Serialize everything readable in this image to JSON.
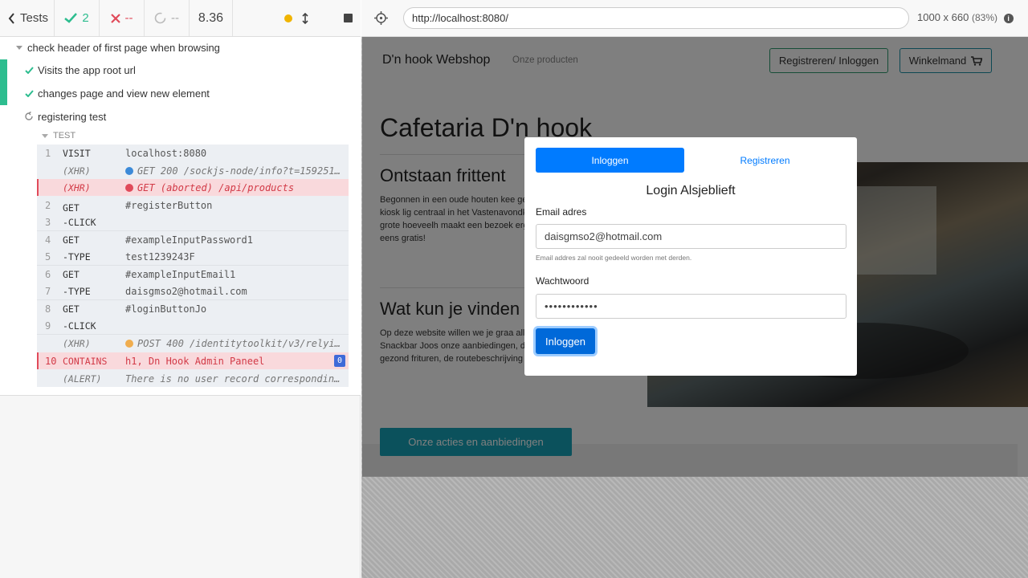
{
  "reporter": {
    "header": {
      "back_label": "Tests",
      "passed_count": "2",
      "failed_count": "--",
      "pending_count": "--",
      "duration": "8.36"
    },
    "suite_title": "check header of first page when browsing",
    "tests": [
      {
        "title": "Visits the app root url",
        "state": "passed"
      },
      {
        "title": "changes page and view new element",
        "state": "passed"
      },
      {
        "title": "registering test",
        "state": "running"
      }
    ],
    "section_label": "TEST",
    "commands": [
      {
        "num": "1",
        "name": "VISIT",
        "message": "localhost:8080",
        "type": "cmd"
      },
      {
        "num": "",
        "name": "(XHR)",
        "message": "GET 200 /sockjs-node/info?t=159251…",
        "type": "xhr",
        "dot": "#3c8ad8"
      },
      {
        "num": "",
        "name": "(XHR)",
        "message": "GET (aborted) /api/products",
        "type": "xhr-err",
        "dot": "#e04a5a"
      },
      {
        "num": "2",
        "name": "GET",
        "message": "#registerButton",
        "type": "cmd"
      },
      {
        "num": "3",
        "name": "-CLICK",
        "message": "",
        "type": "cmd"
      },
      {
        "num": "4",
        "name": "GET",
        "message": "#exampleInputPassword1",
        "type": "cmd"
      },
      {
        "num": "5",
        "name": "-TYPE",
        "message": "test1239243F",
        "type": "cmd"
      },
      {
        "num": "6",
        "name": "GET",
        "message": "#exampleInputEmail1",
        "type": "cmd"
      },
      {
        "num": "7",
        "name": "-TYPE",
        "message": "daisgmso2@hotmail.com",
        "type": "cmd"
      },
      {
        "num": "8",
        "name": "GET",
        "message": "#loginButtonJo",
        "type": "cmd"
      },
      {
        "num": "9",
        "name": "-CLICK",
        "message": "",
        "type": "cmd"
      },
      {
        "num": "",
        "name": "(XHR)",
        "message": "POST 400 /identitytoolkit/v3/relyi…",
        "type": "xhr",
        "dot": "#f0ad4e"
      },
      {
        "num": "10",
        "name": "CONTAINS",
        "message": "h1, Dn Hook Admin Paneel",
        "type": "err",
        "badge": "0"
      },
      {
        "num": "",
        "name": "(ALERT)",
        "message": "There is no user record correspondin…",
        "type": "alert"
      }
    ]
  },
  "aut": {
    "url": "http://localhost:8080/",
    "viewport": "1000 x 660",
    "scale": "(83%)",
    "site": {
      "brand": "D'n hook Webshop",
      "nav_link": "Onze producten",
      "register_login_button": "Registreren/ Inloggen",
      "cart_button": "Winkelmand",
      "page_title": "Cafetaria D'n hook",
      "section1_title": "Ontstaan frittent",
      "section1_text": "Begonnen in een oude houten kee gevestigd in een moderne kiosk lig centraal in het Vastenavondkamp Venlo-Blerick. Een grote hoeveelh maakt een bezoek erg gemakkelijk ook nog eens gratis!",
      "section2_title": "Wat kun je vinden",
      "section2_text": "Op deze website willen we je graa alle activiteiten van Snackbar Joos onze aanbiedingen, de bestel-App particulier, gezond frituren, de routebeschrijving en nog veel meer.",
      "promo_button": "Onze acties en aanbiedingen"
    },
    "modal": {
      "tab_login": "Inloggen",
      "tab_register": "Registreren",
      "title": "Login Alsjeblieft",
      "email_label": "Email adres",
      "email_value": "daisgmso2@hotmail.com",
      "email_help": "Email addres zal nooit gedeeld worden met derden.",
      "password_label": "Wachtwoord",
      "password_value": "••••••••••••",
      "submit_label": "Inloggen"
    }
  },
  "colors": {
    "pass": "#2dbd8f",
    "fail": "#e04a5a",
    "primary": "#007bff",
    "teal": "#17a2b8"
  }
}
